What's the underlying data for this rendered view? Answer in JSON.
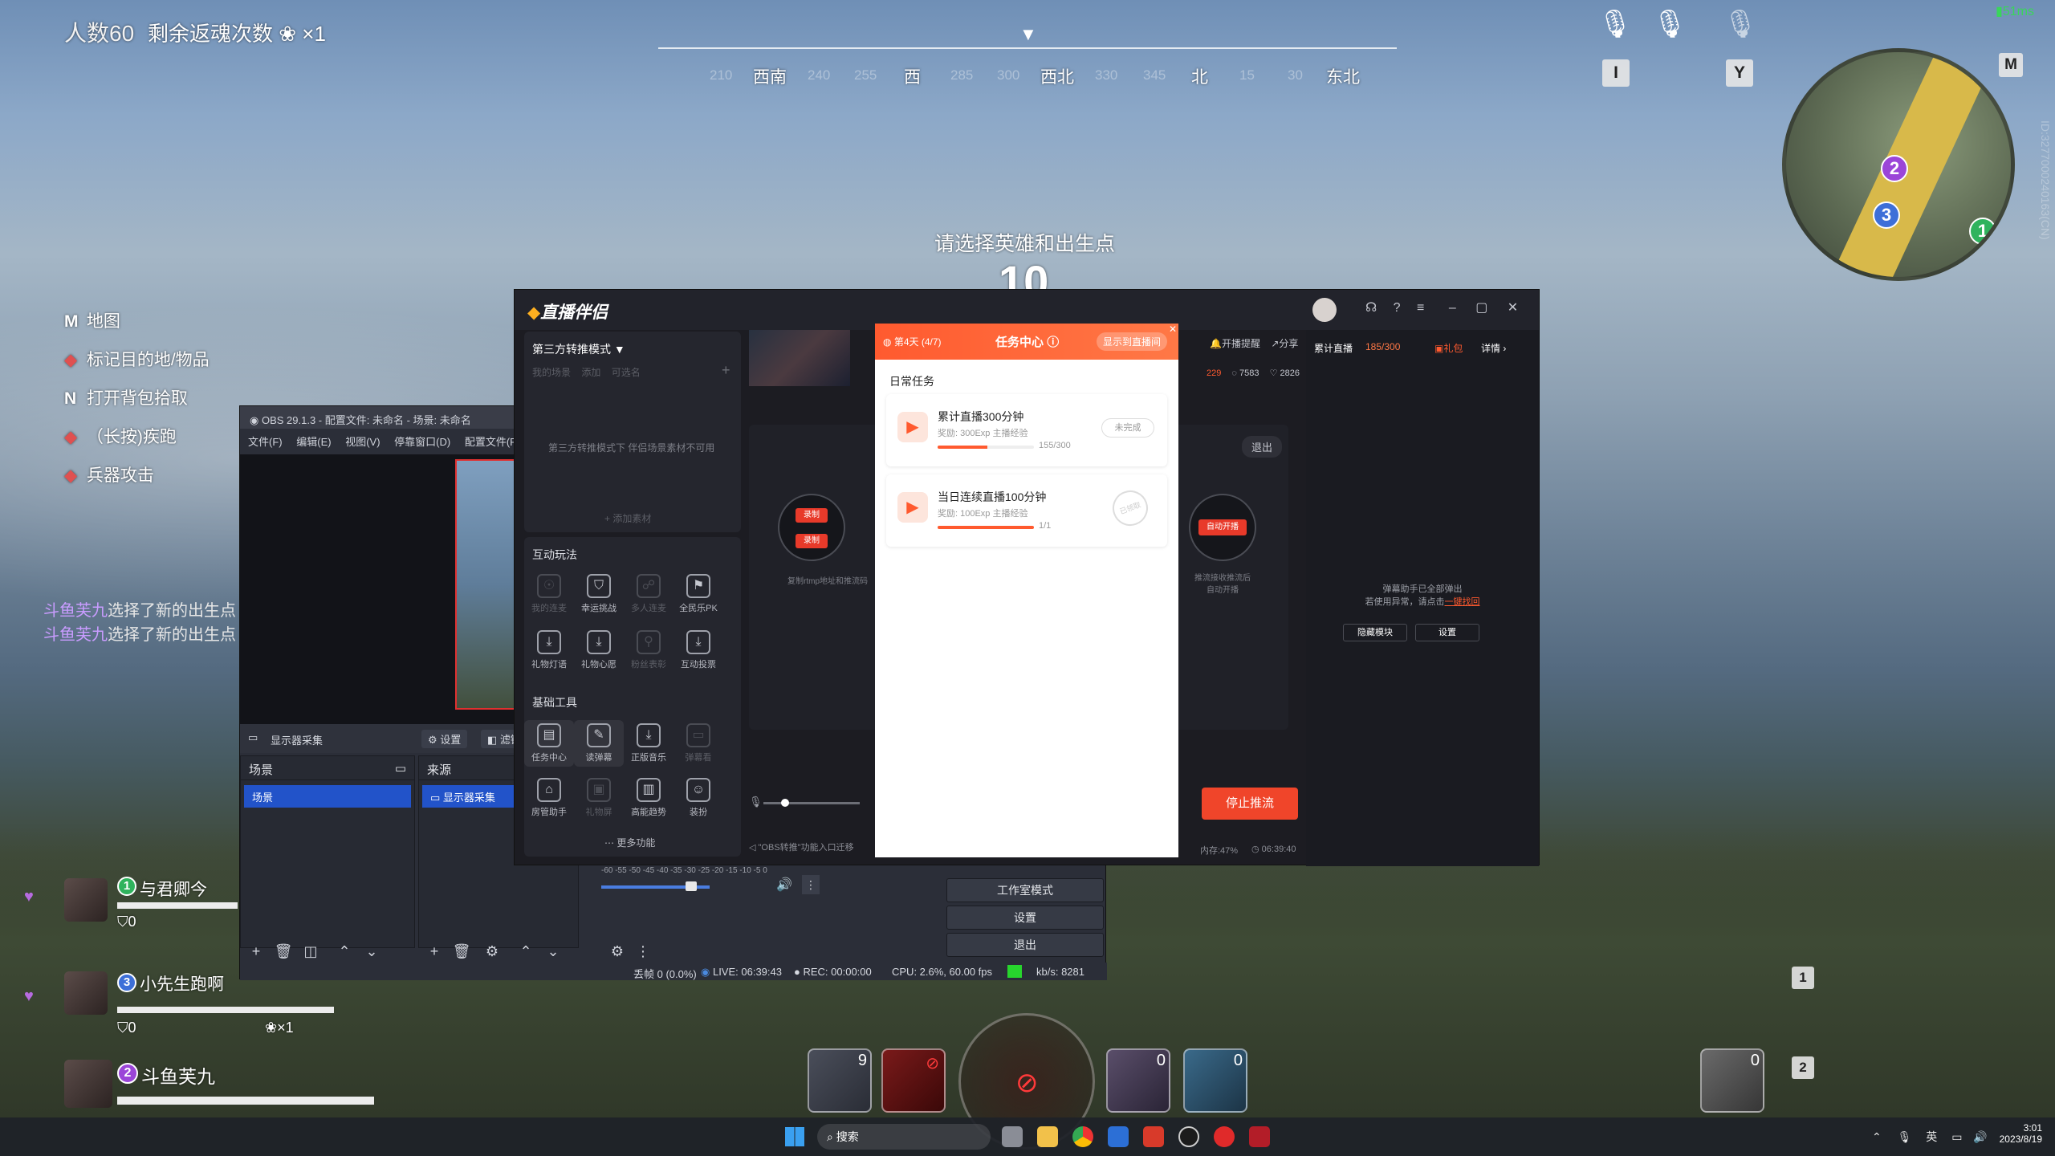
{
  "hud": {
    "alive_count": "人数60",
    "revive_text": "剩余返魂次数",
    "revive_mult": "×1",
    "center_prompt": "请选择英雄和出生点",
    "countdown": "10",
    "net_status": "51ms",
    "side_id": "ID:3277000240163(CN)",
    "map_key": "M",
    "voice_keys": [
      "I",
      "Y"
    ],
    "compass": {
      "dirs": [
        "西南",
        "西",
        "西北",
        "北",
        "东北"
      ],
      "nums": [
        "210",
        "240",
        "255",
        "285",
        "300",
        "330",
        "345",
        "15",
        "30"
      ]
    },
    "left_list": [
      {
        "key": "M",
        "label": "地图"
      },
      {
        "key": "◆",
        "label": "标记目的地/物品"
      },
      {
        "key": "N",
        "label": "打开背包拾取"
      },
      {
        "key": "◆",
        "label": "（长按)疾跑"
      },
      {
        "key": "◆",
        "label": "兵器攻击"
      }
    ],
    "chat": [
      {
        "name": "斗鱼芙九",
        "msg": "选择了新的出生点"
      },
      {
        "name": "斗鱼芙九",
        "msg": "选择了新的出生点"
      }
    ],
    "team": [
      {
        "num": "1",
        "name": "与君卿今",
        "armor": "0"
      },
      {
        "num": "3",
        "name": "小先生跑啊",
        "armor": "0",
        "revive": "×1"
      },
      {
        "num": "2",
        "name": "斗鱼芙九"
      }
    ],
    "mm_markers": [
      "2",
      "3",
      "1"
    ],
    "skill_counts": [
      "9",
      "0",
      "0",
      "0"
    ],
    "slot_keys": [
      "1",
      "2"
    ]
  },
  "obs": {
    "title": "OBS 29.1.3 - 配置文件: 未命名 - 场景: 未命名",
    "menu": [
      "文件(F)",
      "编辑(E)",
      "视图(V)",
      "停靠窗口(D)",
      "配置文件(P)"
    ],
    "source_label": "显示器采集",
    "settings_btn": "设置",
    "filter_btn": "滤镜",
    "scenes_header": "场景",
    "scene_item": "场景",
    "sources_header": "来源",
    "source_item": "显示器采集",
    "controls": [
      "工作室模式",
      "设置",
      "退出"
    ],
    "meter_ticks": "-60 -55 -50 -45 -40 -35 -30 -25 -20 -15 -10 -5 0",
    "status": {
      "dropped": "丢帧 0 (0.0%)",
      "live": "LIVE: 06:39:43",
      "rec": "REC: 00:00:00",
      "cpu": "CPU: 2.6%, 60.00 fps",
      "kbps": "kb/s: 8281"
    }
  },
  "zb": {
    "logo": "直播伴侣",
    "mode": "第三方转推模式",
    "tabs": [
      "我的场景",
      "添加",
      "可选名"
    ],
    "mode_notice": "第三方转推模式下 伴侣场景素材不可用",
    "add_source": "添加素材",
    "interactive_title": "互动玩法",
    "interactive": [
      "我的连麦",
      "幸运挑战",
      "多人连麦",
      "全民乐PK",
      "礼物灯语",
      "礼物心愿",
      "粉丝表彰",
      "互动投票"
    ],
    "basic_title": "基础工具",
    "basic": [
      "任务中心",
      "读弹幕",
      "正版音乐",
      "弹幕看",
      "房管助手",
      "礼物屏",
      "高能趋势",
      "装扮"
    ],
    "more": "更多功能",
    "top_right": [
      "开播提醒",
      "分享"
    ],
    "stats": {
      "a": "229",
      "b": "7583",
      "c": "2826"
    },
    "fans_label": "累计直播",
    "fans_value": "185/300",
    "gift": "礼包",
    "detail": "详情",
    "exit": "退出",
    "record_btn": "录制",
    "record_btn2": "录制",
    "left_hint": "复制rtmp地址和推流码",
    "auto_btn": "自动开播",
    "right_hint1": "推流接收推流后",
    "right_hint2": "自动开播",
    "danmu_hint1": "弹幕助手已全部弹出",
    "danmu_hint2": "若使用异常，请点击",
    "danmu_link": "一键找回",
    "hide_btn": "隐藏模块",
    "set_btn": "设置",
    "stop_btn": "停止推流",
    "obs_note": "\"OBS转推\"功能入口迁移",
    "mem": "内存:47%",
    "time": "06:39:40"
  },
  "task": {
    "day": "第4天",
    "day_progress": "(4/7)",
    "title": "任务中心",
    "show_btn": "显示到直播间",
    "section": "日常任务",
    "items": [
      {
        "title": "累计直播300分钟",
        "reward": "奖励: 300Exp 主播经验",
        "status": "未完成",
        "progress": "155/300",
        "pct": 0.52
      },
      {
        "title": "当日连续直播100分钟",
        "reward": "奖励: 100Exp 主播经验",
        "status": "已领取",
        "progress": "1/1",
        "pct": 1
      }
    ]
  },
  "taskbar": {
    "search": "搜索",
    "lang": "英",
    "time": "3:01",
    "date": "2023/8/19"
  }
}
